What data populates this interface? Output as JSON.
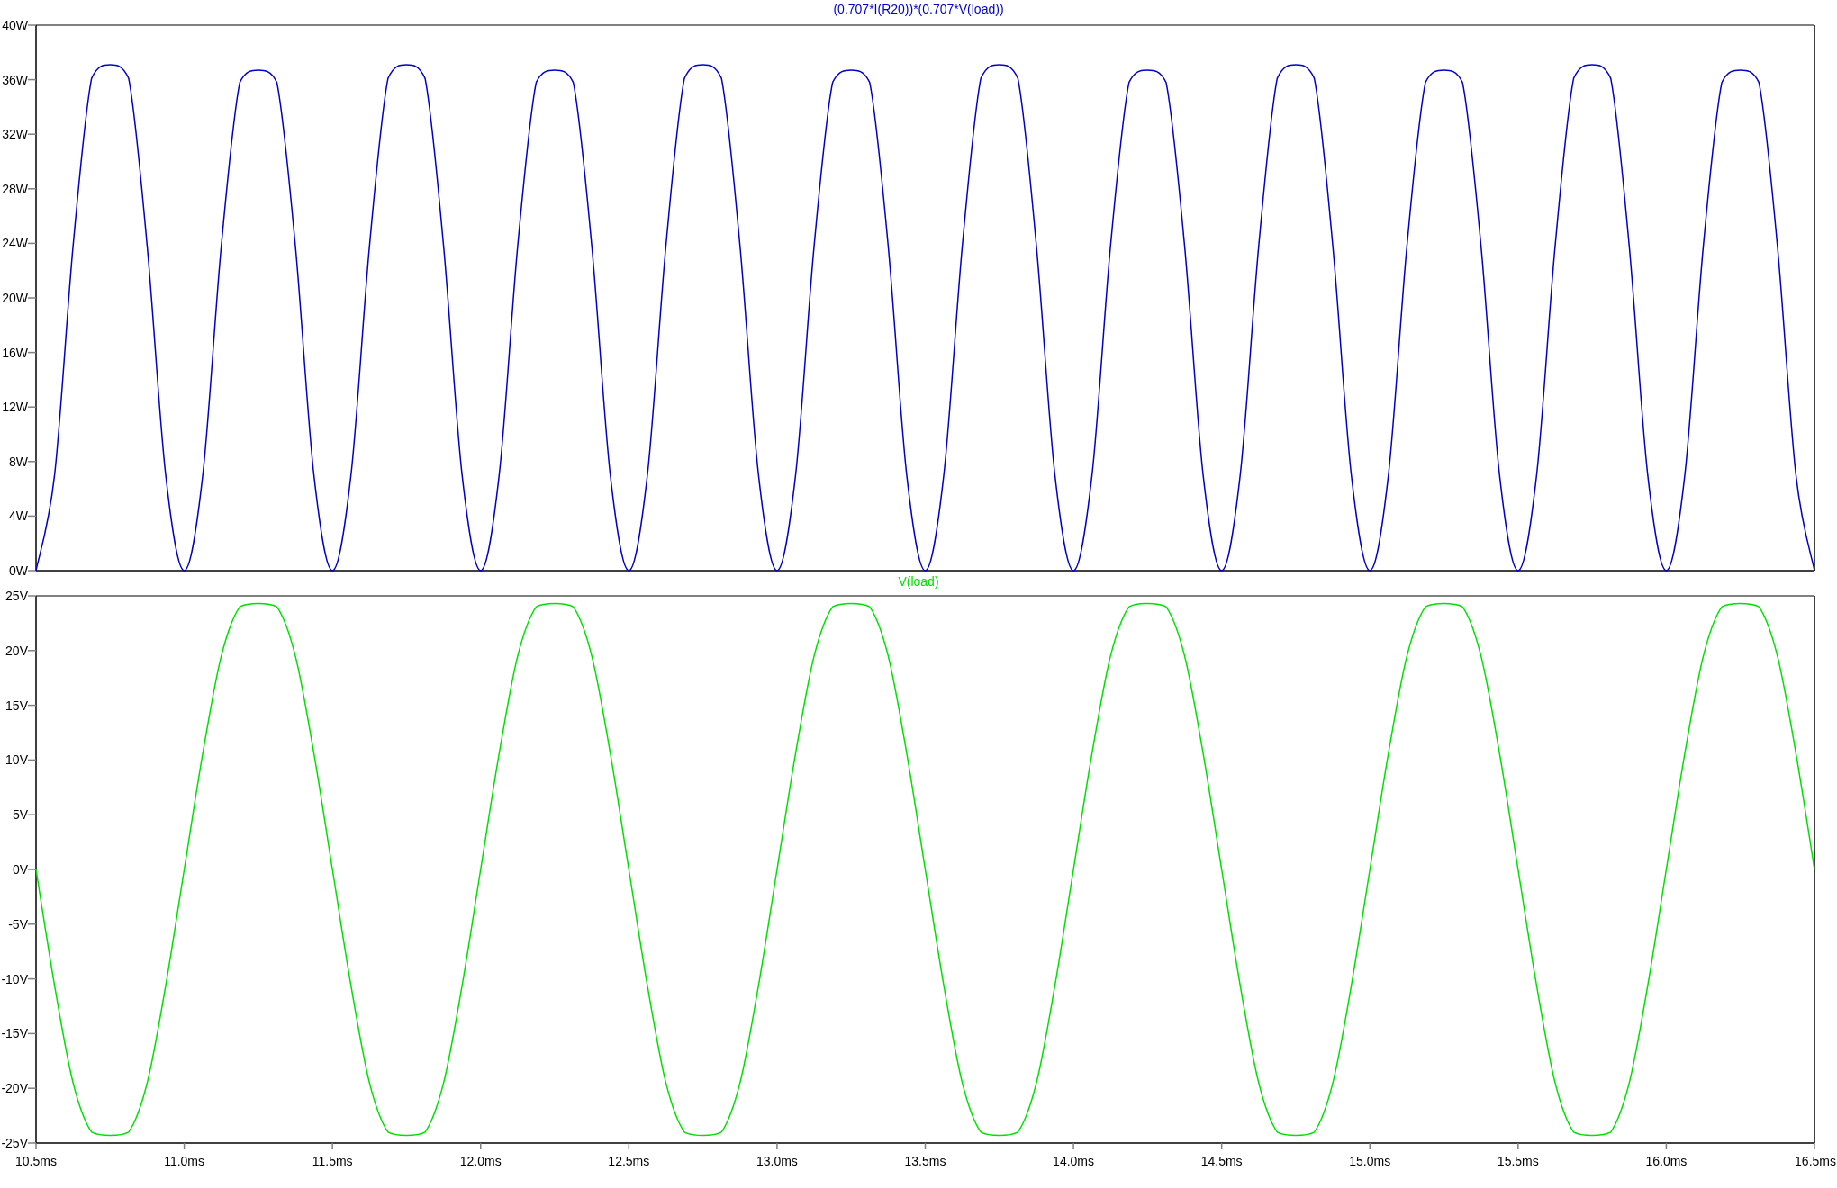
{
  "charts": [
    {
      "chart_data": {
        "type": "line",
        "xlabel": null,
        "x": [
          10.5,
          10.5625,
          10.625,
          10.6875,
          10.75,
          10.8125,
          10.875,
          10.9375,
          11,
          11.0625,
          11.125,
          11.1875,
          11.25,
          11.3125,
          11.375,
          11.4375,
          11.5,
          11.5625,
          11.625,
          11.6875,
          11.75,
          11.8125,
          11.875,
          11.9375,
          12,
          12.0625,
          12.125,
          12.1875,
          12.25,
          12.3125,
          12.375,
          12.4375,
          12.5,
          12.5625,
          12.625,
          12.6875,
          12.75,
          12.8125,
          12.875,
          12.9375,
          13,
          13.0625,
          13.125,
          13.1875,
          13.25,
          13.3125,
          13.375,
          13.4375,
          13.5,
          13.5625,
          13.625,
          13.6875,
          13.75,
          13.8125,
          13.875,
          13.9375,
          14,
          14.0625,
          14.125,
          14.1875,
          14.25,
          14.3125,
          14.375,
          14.4375,
          14.5,
          14.5625,
          14.625,
          14.6875,
          14.75,
          14.8125,
          14.875,
          14.9375,
          15,
          15.0625,
          15.125,
          15.1875,
          15.25,
          15.3125,
          15.375,
          15.4375,
          15.5,
          15.5625,
          15.625,
          15.6875,
          15.75,
          15.8125,
          15.875,
          15.9375,
          16,
          16.0625,
          16.125,
          16.1875,
          16.25,
          16.3125,
          16.375,
          16.4375,
          16.5
        ],
        "series": [
          {
            "name": "(0.707*I(R20))*(0.707*V(load))",
            "color": "#0000c8",
            "values": [
              0,
              7,
              23.8,
              36.1,
              37.1,
              36.1,
              23.8,
              7,
              0,
              7,
              23.8,
              35.8,
              36.7,
              35.8,
              23.8,
              7,
              0,
              7,
              23.8,
              36.1,
              37.1,
              36.1,
              23.8,
              7,
              0,
              7,
              23.8,
              35.8,
              36.7,
              35.8,
              23.8,
              7,
              0,
              7,
              23.8,
              36.1,
              37.1,
              36.1,
              23.8,
              7,
              0,
              7,
              23.8,
              35.8,
              36.7,
              35.8,
              23.8,
              7,
              0,
              7,
              23.8,
              36.1,
              37.1,
              36.1,
              23.8,
              7,
              0,
              7,
              23.8,
              35.8,
              36.7,
              35.8,
              23.8,
              7,
              0,
              7,
              23.8,
              36.1,
              37.1,
              36.1,
              23.8,
              7,
              0,
              7,
              23.8,
              35.8,
              36.7,
              35.8,
              23.8,
              7,
              0,
              7,
              23.8,
              36.1,
              37.1,
              36.1,
              23.8,
              7,
              0,
              7,
              23.8,
              35.8,
              36.7,
              35.8,
              23.8,
              7,
              0
            ]
          }
        ],
        "xlim": [
          10.5,
          16.5
        ],
        "ylim": [
          0,
          40
        ],
        "yticks": [
          {
            "value": 0,
            "label": "0W"
          },
          {
            "value": 4,
            "label": "4W"
          },
          {
            "value": 8,
            "label": "8W"
          },
          {
            "value": 12,
            "label": "12W"
          },
          {
            "value": 16,
            "label": "16W"
          },
          {
            "value": 20,
            "label": "20W"
          },
          {
            "value": 24,
            "label": "24W"
          },
          {
            "value": 28,
            "label": "28W"
          },
          {
            "value": 32,
            "label": "32W"
          },
          {
            "value": 36,
            "label": "36W"
          },
          {
            "value": 40,
            "label": "40W"
          }
        ]
      }
    },
    {
      "chart_data": {
        "type": "line",
        "x": [
          10.5,
          10.5625,
          10.625,
          10.6875,
          10.75,
          10.8125,
          10.875,
          10.9375,
          11,
          11.0625,
          11.125,
          11.1875,
          11.25,
          11.3125,
          11.375,
          11.4375,
          11.5,
          11.5625,
          11.625,
          11.6875,
          11.75,
          11.8125,
          11.875,
          11.9375,
          12,
          12.0625,
          12.125,
          12.1875,
          12.25,
          12.3125,
          12.375,
          12.4375,
          12.5,
          12.5625,
          12.625,
          12.6875,
          12.75,
          12.8125,
          12.875,
          12.9375,
          13,
          13.0625,
          13.125,
          13.1875,
          13.25,
          13.3125,
          13.375,
          13.4375,
          13.5,
          13.5625,
          13.625,
          13.6875,
          13.75,
          13.8125,
          13.875,
          13.9375,
          14,
          14.0625,
          14.125,
          14.1875,
          14.25,
          14.3125,
          14.375,
          14.4375,
          14.5,
          14.5625,
          14.625,
          14.6875,
          14.75,
          14.8125,
          14.875,
          14.9375,
          15,
          15.0625,
          15.125,
          15.1875,
          15.25,
          15.3125,
          15.375,
          15.4375,
          15.5,
          15.5625,
          15.625,
          15.6875,
          15.75,
          15.8125,
          15.875,
          15.9375,
          16,
          16.0625,
          16.125,
          16.1875,
          16.25,
          16.3125,
          16.375,
          16.4375,
          16.5
        ],
        "series": [
          {
            "name": "V(load)",
            "color": "#00e000",
            "values": [
              0,
              -10.6,
              -19.5,
              -24,
              -24.3,
              -24,
              -19.5,
              -10.6,
              0,
              10.6,
              19.5,
              24,
              24.3,
              24,
              19.5,
              10.6,
              0,
              -10.6,
              -19.5,
              -24,
              -24.3,
              -24,
              -19.5,
              -10.6,
              0,
              10.6,
              19.5,
              24,
              24.3,
              24,
              19.5,
              10.6,
              0,
              -10.6,
              -19.5,
              -24,
              -24.3,
              -24,
              -19.5,
              -10.6,
              0,
              10.6,
              19.5,
              24,
              24.3,
              24,
              19.5,
              10.6,
              0,
              -10.6,
              -19.5,
              -24,
              -24.3,
              -24,
              -19.5,
              -10.6,
              0,
              10.6,
              19.5,
              24,
              24.3,
              24,
              19.5,
              10.6,
              0,
              -10.6,
              -19.5,
              -24,
              -24.3,
              -24,
              -19.5,
              -10.6,
              0,
              10.6,
              19.5,
              24,
              24.3,
              24,
              19.5,
              10.6,
              0,
              -10.6,
              -19.5,
              -24,
              -24.3,
              -24,
              -19.5,
              -10.6,
              0,
              10.6,
              19.5,
              24,
              24.3,
              24,
              19.5,
              10.6,
              0
            ]
          }
        ],
        "xlim": [
          10.5,
          16.5
        ],
        "ylim": [
          -25,
          25
        ],
        "yticks": [
          {
            "value": -25,
            "label": "-25V"
          },
          {
            "value": -20,
            "label": "-20V"
          },
          {
            "value": -15,
            "label": "-15V"
          },
          {
            "value": -10,
            "label": "-10V"
          },
          {
            "value": -5,
            "label": "-5V"
          },
          {
            "value": 0,
            "label": "0V"
          },
          {
            "value": 5,
            "label": "5V"
          },
          {
            "value": 10,
            "label": "10V"
          },
          {
            "value": 15,
            "label": "15V"
          },
          {
            "value": 20,
            "label": "20V"
          },
          {
            "value": 25,
            "label": "25V"
          }
        ],
        "xticks": [
          {
            "value": 10.5,
            "label": "10.5ms"
          },
          {
            "value": 11,
            "label": "11.0ms"
          },
          {
            "value": 11.5,
            "label": "11.5ms"
          },
          {
            "value": 12,
            "label": "12.0ms"
          },
          {
            "value": 12.5,
            "label": "12.5ms"
          },
          {
            "value": 13,
            "label": "13.0ms"
          },
          {
            "value": 13.5,
            "label": "13.5ms"
          },
          {
            "value": 14,
            "label": "14.0ms"
          },
          {
            "value": 14.5,
            "label": "14.5ms"
          },
          {
            "value": 15,
            "label": "15.0ms"
          },
          {
            "value": 15.5,
            "label": "15.5ms"
          },
          {
            "value": 16,
            "label": "16.0ms"
          },
          {
            "value": 16.5,
            "label": "16.5ms"
          }
        ]
      }
    }
  ]
}
